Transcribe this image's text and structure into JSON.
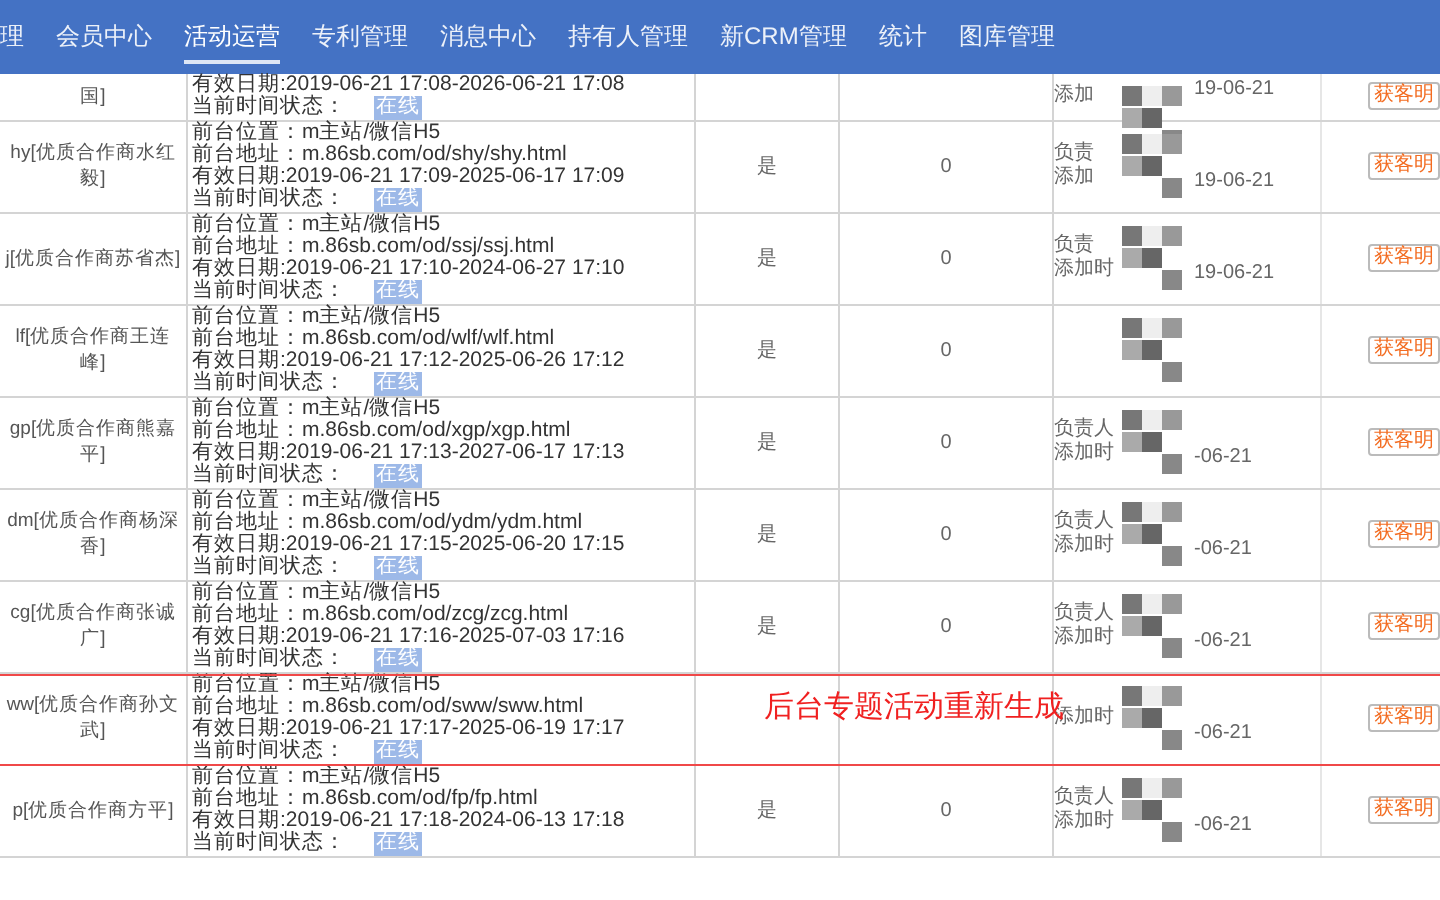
{
  "nav": [
    {
      "label": "理",
      "selected": false
    },
    {
      "label": "会员中心",
      "selected": false
    },
    {
      "label": "活动运营",
      "selected": true
    },
    {
      "label": "专利管理",
      "selected": false
    },
    {
      "label": "消息中心",
      "selected": false
    },
    {
      "label": "持有人管理",
      "selected": false
    },
    {
      "label": "新CRM管理",
      "selected": false
    },
    {
      "label": "统计",
      "selected": false
    },
    {
      "label": "图库管理",
      "selected": false
    }
  ],
  "rows": [
    {
      "name": [
        "国]"
      ],
      "lines": [
        "有效日期:2019-06-21 17:08-2026-06-21 17:08"
      ],
      "status_label": "当前时间状态：",
      "status": "在线",
      "flag": "",
      "count": "",
      "owner": [
        "添加"
      ],
      "date": "19-06-21",
      "action": "获客明"
    },
    {
      "name": [
        "hy[优质合作商水红",
        "毅]"
      ],
      "lines": [
        "前台位置：m主站/微信H5",
        "前台地址：m.86sb.com/od/shy/shy.html",
        "有效日期:2019-06-21 17:09-2025-06-17 17:09"
      ],
      "status_label": "当前时间状态：",
      "status": "在线",
      "flag": "是",
      "count": "0",
      "owner": [
        "负责",
        "添加"
      ],
      "date": "19-06-21",
      "action": "获客明"
    },
    {
      "name": [
        "j[优质合作商苏省杰]"
      ],
      "lines": [
        "前台位置：m主站/微信H5",
        "前台地址：m.86sb.com/od/ssj/ssj.html",
        "有效日期:2019-06-21 17:10-2024-06-27 17:10"
      ],
      "status_label": "当前时间状态：",
      "status": "在线",
      "flag": "是",
      "count": "0",
      "owner": [
        "负责",
        "添加时"
      ],
      "date": "19-06-21",
      "action": "获客明"
    },
    {
      "name": [
        "lf[优质合作商王连",
        "峰]"
      ],
      "lines": [
        "前台位置：m主站/微信H5",
        "前台地址：m.86sb.com/od/wlf/wlf.html",
        "有效日期:2019-06-21 17:12-2025-06-26 17:12"
      ],
      "status_label": "当前时间状态：",
      "status": "在线",
      "flag": "是",
      "count": "0",
      "owner": [],
      "date": "",
      "action": "获客明"
    },
    {
      "name": [
        "gp[优质合作商熊嘉",
        "平]"
      ],
      "lines": [
        "前台位置：m主站/微信H5",
        "前台地址：m.86sb.com/od/xgp/xgp.html",
        "有效日期:2019-06-21 17:13-2027-06-17 17:13"
      ],
      "status_label": "当前时间状态：",
      "status": "在线",
      "flag": "是",
      "count": "0",
      "owner": [
        "负责人",
        "添加时"
      ],
      "date": "-06-21",
      "action": "获客明"
    },
    {
      "name": [
        "dm[优质合作商杨深",
        "香]"
      ],
      "lines": [
        "前台位置：m主站/微信H5",
        "前台地址：m.86sb.com/od/ydm/ydm.html",
        "有效日期:2019-06-21 17:15-2025-06-20 17:15"
      ],
      "status_label": "当前时间状态：",
      "status": "在线",
      "flag": "是",
      "count": "0",
      "owner": [
        "负责人",
        "添加时"
      ],
      "date": "-06-21",
      "action": "获客明"
    },
    {
      "name": [
        "cg[优质合作商张诚",
        "广]"
      ],
      "lines": [
        "前台位置：m主站/微信H5",
        "前台地址：m.86sb.com/od/zcg/zcg.html",
        "有效日期:2019-06-21 17:16-2025-07-03 17:16"
      ],
      "status_label": "当前时间状态：",
      "status": "在线",
      "flag": "是",
      "count": "0",
      "owner": [
        "负责人",
        "添加时"
      ],
      "date": "-06-21",
      "action": "获客明"
    },
    {
      "name": [
        "ww[优质合作商孙文",
        "武]"
      ],
      "lines": [
        "前台位置：m主站/微信H5",
        "前台地址：m.86sb.com/od/sww/sww.html",
        "有效日期:2019-06-21 17:17-2025-06-19 17:17"
      ],
      "status_label": "当前时间状态：",
      "status": "在线",
      "flag": "",
      "count": "",
      "owner": [
        "添加时"
      ],
      "date": "-06-21",
      "action": "获客明"
    },
    {
      "name": [
        "p[优质合作商方平]"
      ],
      "lines": [
        "前台位置：m主站/微信H5",
        "前台地址：m.86sb.com/od/fp/fp.html",
        "有效日期:2019-06-21 17:18-2024-06-13 17:18"
      ],
      "status_label": "当前时间状态：",
      "status": "在线",
      "flag": "是",
      "count": "0",
      "owner": [
        "负责人",
        "添加时"
      ],
      "date": "-06-21",
      "action": "获客明"
    }
  ],
  "annotation": "后台专题活动重新生成"
}
